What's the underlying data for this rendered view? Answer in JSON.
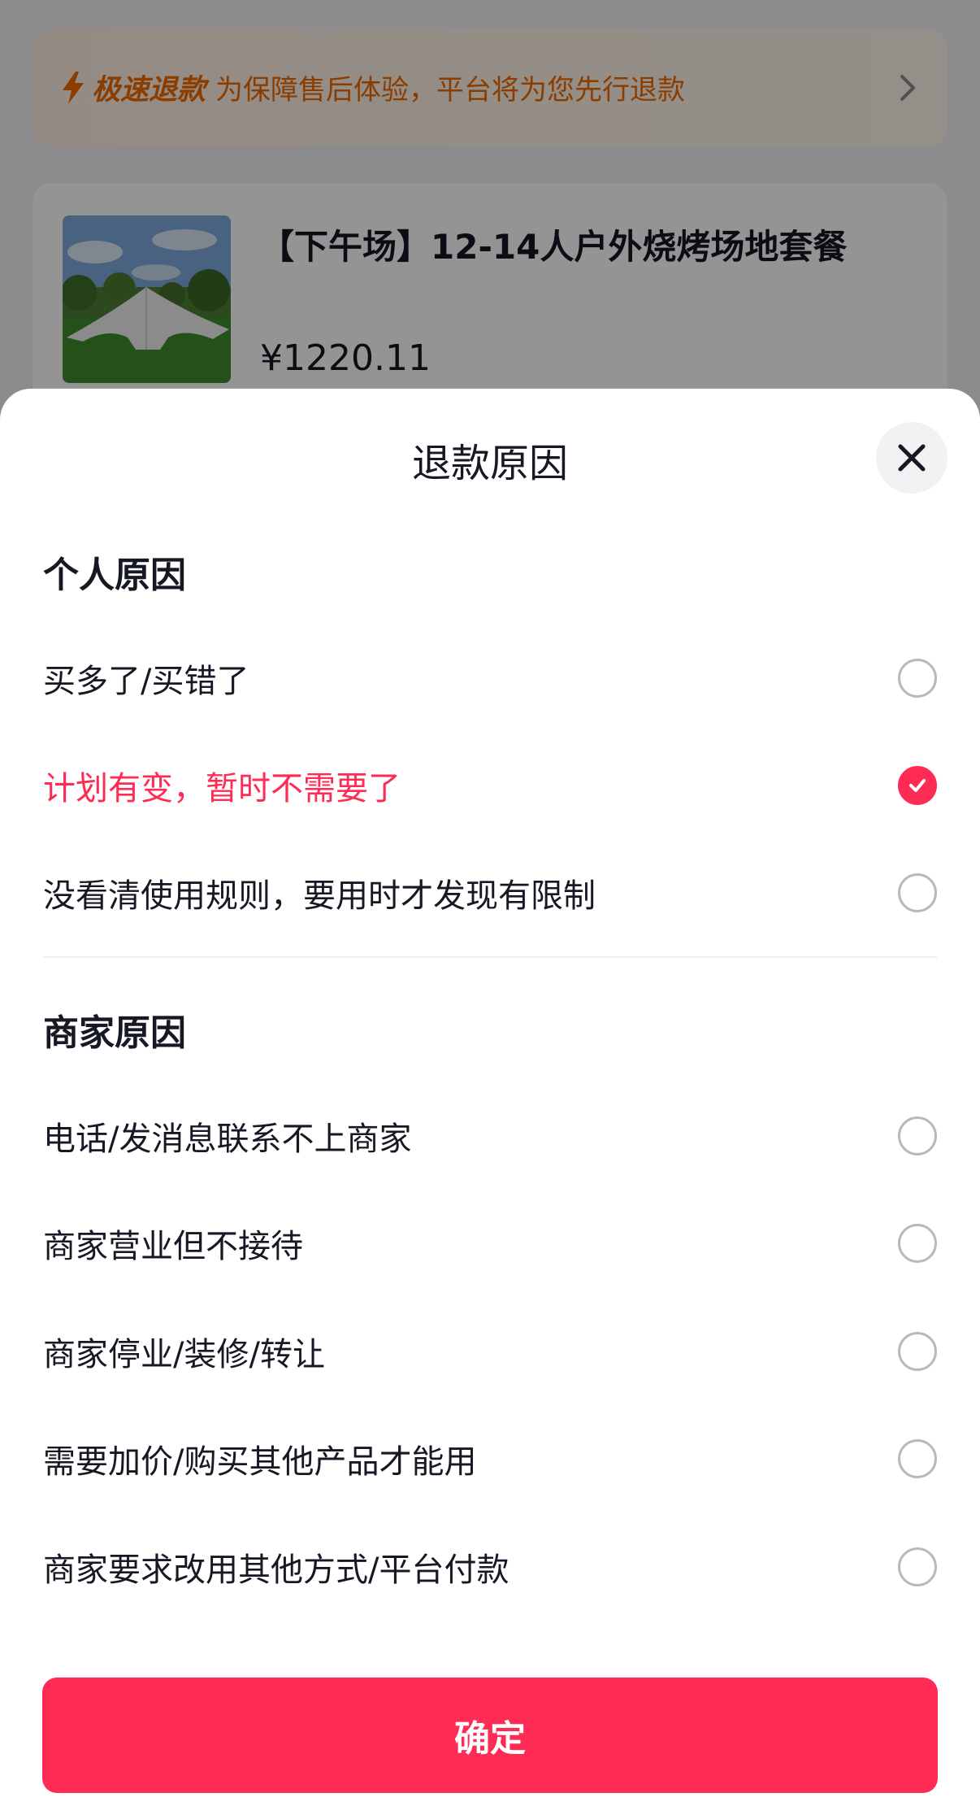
{
  "background": {
    "banner": {
      "icon": "lightning-icon",
      "strong_text": "极速退款",
      "text": "为保障售后体验，平台将为您先行退款",
      "arrow_icon": "chevron-right-icon"
    },
    "product": {
      "title": "【下午场】12-14人户外烧烤场地套餐",
      "price": "¥1220.11"
    }
  },
  "sheet": {
    "title": "退款原因",
    "close_icon": "close-icon",
    "sections": [
      {
        "title": "个人原因",
        "options": [
          {
            "label": "买多了/买错了",
            "selected": false
          },
          {
            "label": "计划有变，暂时不需要了",
            "selected": true
          },
          {
            "label": "没看清使用规则，要用时才发现有限制",
            "selected": false
          }
        ]
      },
      {
        "title": "商家原因",
        "options": [
          {
            "label": "电话/发消息联系不上商家",
            "selected": false
          },
          {
            "label": "商家营业但不接待",
            "selected": false
          },
          {
            "label": "商家停业/装修/转让",
            "selected": false
          },
          {
            "label": "需要加价/购买其他产品才能用",
            "selected": false
          },
          {
            "label": "商家要求改用其他方式/平台付款",
            "selected": false
          }
        ]
      }
    ],
    "confirm_label": "确定"
  },
  "colors": {
    "accent": "#fe2c55",
    "banner_text": "#f06a00",
    "text_primary": "#161823"
  }
}
